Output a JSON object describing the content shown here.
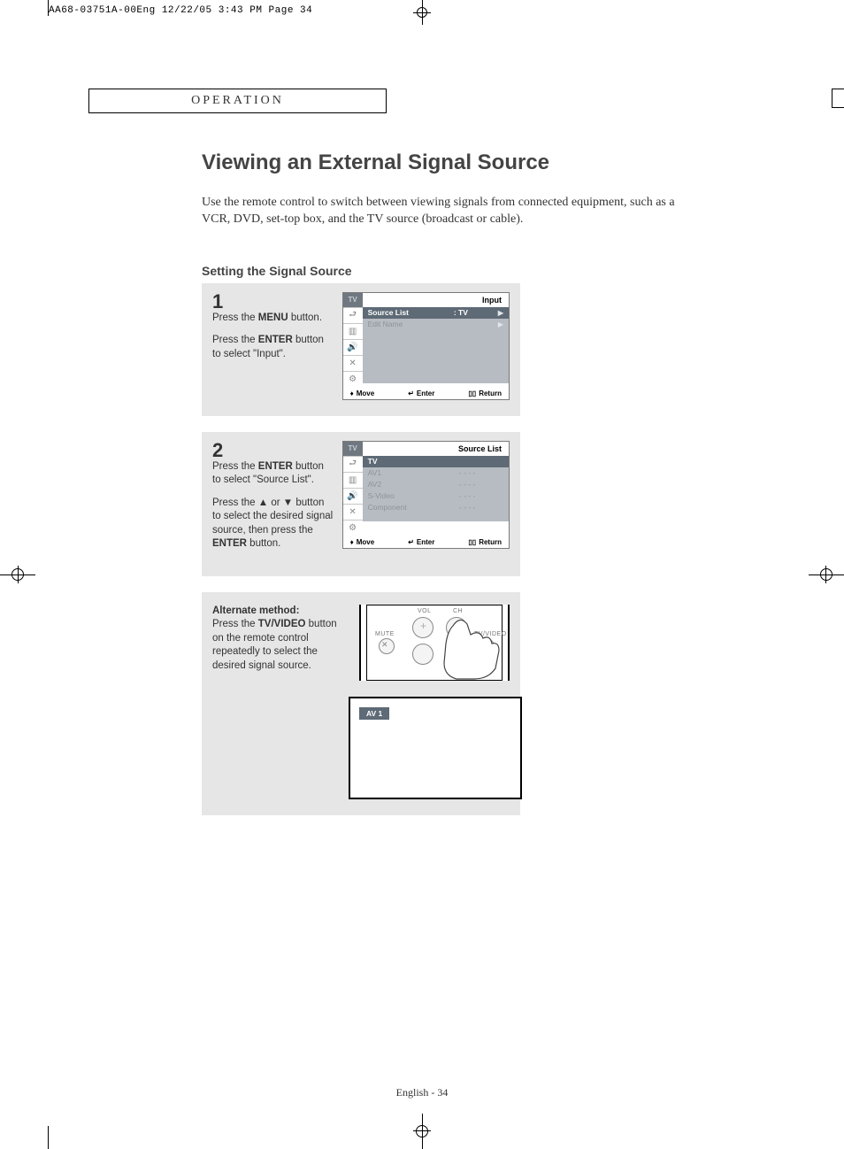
{
  "print_header": "AA68-03751A-00Eng  12/22/05  3:43 PM  Page 34",
  "section_label": "OPERATION",
  "title": "Viewing an External Signal Source",
  "intro": "Use the remote control to switch between viewing signals from connected equipment, such as a VCR, DVD, set-top box, and the TV source (broadcast or cable).",
  "subheading": "Setting the Signal Source",
  "step1": {
    "num": "1",
    "line1_a": "Press the ",
    "line1_b": "MENU",
    "line1_c": " button.",
    "line2_a": "Press the ",
    "line2_b": "ENTER",
    "line2_c": " button to select \"Input\".",
    "osd_tv": "TV",
    "osd_title": "Input",
    "row1_label": "Source List",
    "row1_val": ": TV",
    "row2_label": "Edit Name",
    "footer_move": "Move",
    "footer_enter": "Enter",
    "footer_return": "Return"
  },
  "step2": {
    "num": "2",
    "p1_a": "Press the ",
    "p1_b": "ENTER",
    "p1_c": " button to select \"Source List\".",
    "p2_a": "Press the ",
    "p2_b": "▲",
    "p2_c": " or ",
    "p2_d": "▼",
    "p2_e": " button to select the desired signal source, then press the ",
    "p2_f": "ENTER",
    "p2_g": " button.",
    "osd_tv": "TV",
    "osd_title": "Source List",
    "rows": [
      {
        "label": "TV",
        "val": ""
      },
      {
        "label": "AV1",
        "val": "- - - -"
      },
      {
        "label": "AV2",
        "val": "- - - -"
      },
      {
        "label": "S-Video",
        "val": "- - - -"
      },
      {
        "label": "Component",
        "val": "- - - -"
      }
    ],
    "footer_move": "Move",
    "footer_enter": "Enter",
    "footer_return": "Return"
  },
  "alt": {
    "heading": "Alternate method:",
    "text_a": "Press the ",
    "text_b": "TV/VIDEO",
    "text_c": " button on the remote control repeatedly to select the desired signal source.",
    "lbl_vol": "VOL",
    "lbl_ch": "CH",
    "lbl_mute": "MUTE",
    "lbl_tvvideo": "TV/VIDEO",
    "av_chip": "AV 1"
  },
  "footer": "English - 34"
}
